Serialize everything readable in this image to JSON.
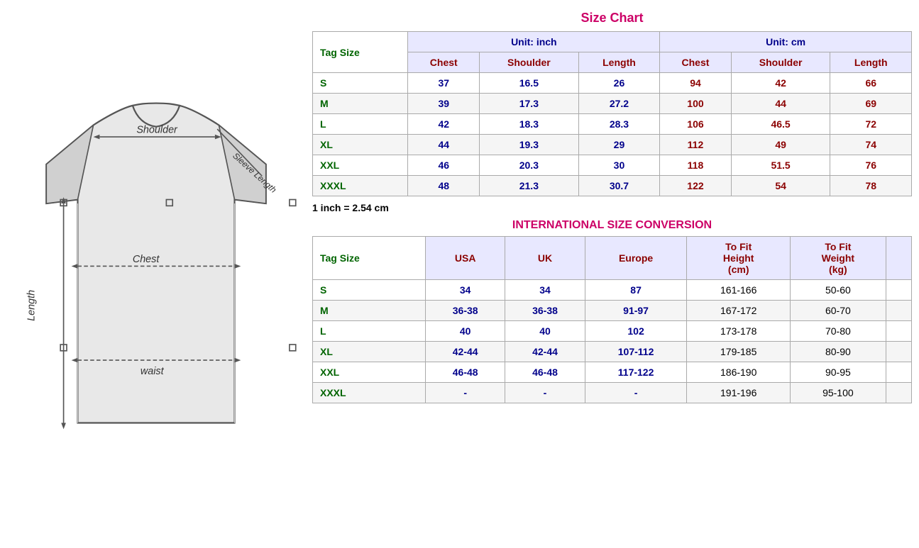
{
  "sizeChart": {
    "title": "Size Chart",
    "unitInch": "Unit: inch",
    "unitCm": "Unit: cm",
    "tagSizeLabel": "Tag Size",
    "columns": {
      "inch": [
        "Chest",
        "Shoulder",
        "Length"
      ],
      "cm": [
        "Chest",
        "Shoulder",
        "Length"
      ]
    },
    "rows": [
      {
        "tag": "S",
        "inch": {
          "chest": "37",
          "shoulder": "16.5",
          "length": "26"
        },
        "cm": {
          "chest": "94",
          "shoulder": "42",
          "length": "66"
        }
      },
      {
        "tag": "M",
        "inch": {
          "chest": "39",
          "shoulder": "17.3",
          "length": "27.2"
        },
        "cm": {
          "chest": "100",
          "shoulder": "44",
          "length": "69"
        }
      },
      {
        "tag": "L",
        "inch": {
          "chest": "42",
          "shoulder": "18.3",
          "length": "28.3"
        },
        "cm": {
          "chest": "106",
          "shoulder": "46.5",
          "length": "72"
        }
      },
      {
        "tag": "XL",
        "inch": {
          "chest": "44",
          "shoulder": "19.3",
          "length": "29"
        },
        "cm": {
          "chest": "112",
          "shoulder": "49",
          "length": "74"
        }
      },
      {
        "tag": "XXL",
        "inch": {
          "chest": "46",
          "shoulder": "20.3",
          "length": "30"
        },
        "cm": {
          "chest": "118",
          "shoulder": "51.5",
          "length": "76"
        }
      },
      {
        "tag": "XXXL",
        "inch": {
          "chest": "48",
          "shoulder": "21.3",
          "length": "30.7"
        },
        "cm": {
          "chest": "122",
          "shoulder": "54",
          "length": "78"
        }
      }
    ],
    "inchNote": "1 inch = 2.54 cm"
  },
  "intlConversion": {
    "title": "INTERNATIONAL SIZE CONVERSION",
    "tagSizeLabel": "Tag Size",
    "columns": [
      "USA",
      "UK",
      "Europe",
      "To Fit Height (cm)",
      "To Fit Weight (kg)"
    ],
    "rows": [
      {
        "tag": "S",
        "usa": "34",
        "uk": "34",
        "europe": "87",
        "height": "161-166",
        "weight": "50-60"
      },
      {
        "tag": "M",
        "usa": "36-38",
        "uk": "36-38",
        "europe": "91-97",
        "height": "167-172",
        "weight": "60-70"
      },
      {
        "tag": "L",
        "usa": "40",
        "uk": "40",
        "europe": "102",
        "height": "173-178",
        "weight": "70-80"
      },
      {
        "tag": "XL",
        "usa": "42-44",
        "uk": "42-44",
        "europe": "107-112",
        "height": "179-185",
        "weight": "80-90"
      },
      {
        "tag": "XXL",
        "usa": "46-48",
        "uk": "46-48",
        "europe": "117-122",
        "height": "186-190",
        "weight": "90-95"
      },
      {
        "tag": "XXXL",
        "usa": "-",
        "uk": "-",
        "europe": "-",
        "height": "191-196",
        "weight": "95-100"
      }
    ]
  },
  "diagram": {
    "labels": {
      "shoulder": "Shoulder",
      "chest": "Chest",
      "length": "Length",
      "waist": "waist",
      "sleeveLength": "Sleeve Length"
    }
  }
}
